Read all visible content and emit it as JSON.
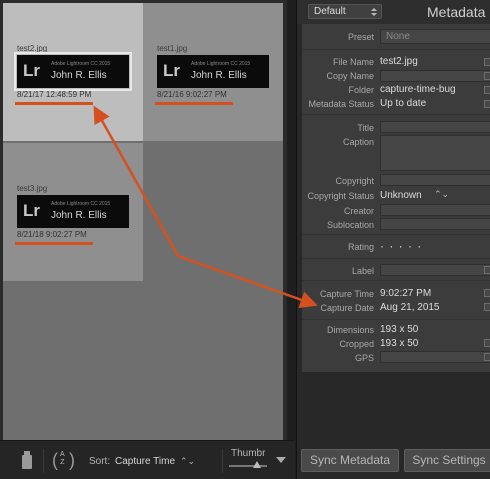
{
  "grid": {
    "cells": [
      {
        "filename": "test2.jpg",
        "brand": "Adobe Lightroom CC 2015",
        "author": "John R. Ellis",
        "capture_time": "8/21/17 12:48:59 PM",
        "selected": true
      },
      {
        "filename": "test1.jpg",
        "brand": "Adobe Lightroom CC 2015",
        "author": "John R. Ellis",
        "capture_time": "8/21/16 9:02:27 PM",
        "selected": false
      },
      {
        "filename": "test3.jpg",
        "brand": "Adobe Lightroom CC 2015",
        "author": "John R. Ellis",
        "capture_time": "8/21/18 9:02:27 PM",
        "selected": false
      }
    ],
    "lr_logo": "Lr"
  },
  "toolbar": {
    "sort_label": "Sort:",
    "sort_value": "Capture Time",
    "sort_icon_az": "A\nZ",
    "thumbnail_label": "Thumbr"
  },
  "meta": {
    "preset_dropdown": "Default",
    "panel_title": "Metadata",
    "preset_label": "Preset",
    "preset_value": "None",
    "file_name_label": "File Name",
    "file_name": "test2.jpg",
    "copy_name_label": "Copy Name",
    "folder_label": "Folder",
    "folder": "capture-time-bug",
    "metadata_status_label": "Metadata Status",
    "metadata_status": "Up to date",
    "title_label": "Title",
    "caption_label": "Caption",
    "copyright_label": "Copyright",
    "copyright_status_label": "Copyright Status",
    "copyright_status": "Unknown",
    "creator_label": "Creator",
    "sublocation_label": "Sublocation",
    "rating_label": "Rating",
    "rating": "· · · · ·",
    "label_label": "Label",
    "capture_time_label": "Capture Time",
    "capture_time": "9:02:27 PM",
    "capture_date_label": "Capture Date",
    "capture_date": "Aug 21, 2015",
    "dimensions_label": "Dimensions",
    "dimensions": "193 x 50",
    "cropped_label": "Cropped",
    "cropped": "193 x 50",
    "gps_label": "GPS"
  },
  "buttons": {
    "sync_metadata": "Sync Metadata",
    "sync_settings": "Sync Settings"
  },
  "colors": {
    "annotation": "#d4511f",
    "selected_cell": "#bdbdbd",
    "cell": "#8f8f8f"
  }
}
